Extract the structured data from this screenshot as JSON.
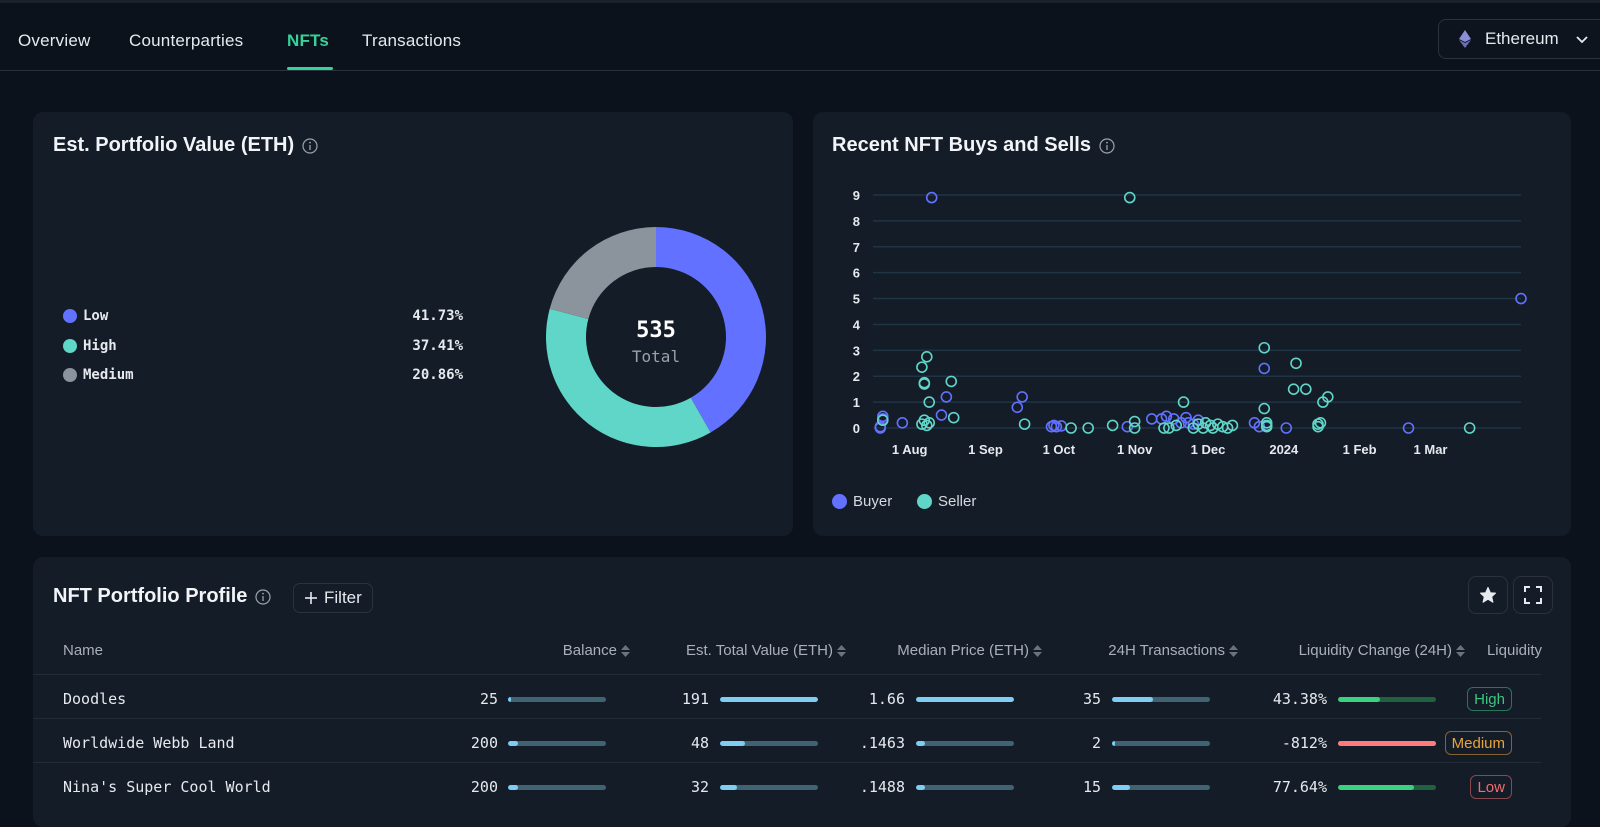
{
  "nav": {
    "tabs": [
      {
        "label": "Overview",
        "active": false
      },
      {
        "label": "Counterparties",
        "active": false
      },
      {
        "label": "NFTs",
        "active": true
      },
      {
        "label": "Transactions",
        "active": false
      }
    ],
    "chain_selector": {
      "label": "Ethereum",
      "icon": "ethereum-icon"
    }
  },
  "colors": {
    "accent": "#35d39a",
    "low": "#6271ff",
    "high": "#5fd6c8",
    "medium": "#8b939c",
    "buyer": "#6271ff",
    "seller": "#5fd6c8"
  },
  "portfolio_value": {
    "title": "Est. Portfolio Value (ETH)",
    "total_value": "535",
    "total_label": "Total",
    "legend": [
      {
        "label": "Low",
        "pct_text": "41.73%",
        "color": "#6271ff"
      },
      {
        "label": "High",
        "pct_text": "37.41%",
        "color": "#5fd6c8"
      },
      {
        "label": "Medium",
        "pct_text": "20.86%",
        "color": "#8b939c"
      }
    ]
  },
  "buys_sells": {
    "title": "Recent NFT Buys and Sells",
    "legend": [
      {
        "label": "Buyer",
        "color": "#6271ff"
      },
      {
        "label": "Seller",
        "color": "#5fd6c8"
      }
    ]
  },
  "chart_data": [
    {
      "type": "pie",
      "title": "Est. Portfolio Value (ETH)",
      "center_text": "535 Total",
      "labels": [
        "Low",
        "High",
        "Medium"
      ],
      "values": [
        41.73,
        37.41,
        20.86
      ],
      "colors": [
        "#6271ff",
        "#5fd6c8",
        "#8b939c"
      ]
    },
    {
      "type": "scatter",
      "title": "Recent NFT Buys and Sells",
      "xlabel": "",
      "ylabel": "",
      "ylim": [
        0,
        9
      ],
      "yticks": [
        "0",
        "1",
        "2",
        "3",
        "4",
        "5",
        "6",
        "7",
        "8",
        "9"
      ],
      "xlim_days": [
        -15,
        250
      ],
      "xticks": [
        {
          "label": "1 Aug",
          "day": 0
        },
        {
          "label": "1 Sep",
          "day": 31
        },
        {
          "label": "1 Oct",
          "day": 61
        },
        {
          "label": "1 Nov",
          "day": 92
        },
        {
          "label": "1 Dec",
          "day": 122
        },
        {
          "label": "2024",
          "day": 153
        },
        {
          "label": "1 Feb",
          "day": 184
        },
        {
          "label": "1 Mar",
          "day": 213
        }
      ],
      "grid": true,
      "legend": "bottom-left",
      "series": [
        {
          "name": "Buyer",
          "color": "#6271ff",
          "points": [
            [
              -12,
              0.0
            ],
            [
              -12,
              0.05
            ],
            [
              -11,
              0.35
            ],
            [
              -11,
              0.45
            ],
            [
              -3,
              0.2
            ],
            [
              13,
              0.5
            ],
            [
              15,
              1.2
            ],
            [
              44,
              0.8
            ],
            [
              46,
              1.2
            ],
            [
              58,
              0.05
            ],
            [
              59,
              0.1
            ],
            [
              60,
              0.05
            ],
            [
              62,
              0.08
            ],
            [
              89,
              0.05
            ],
            [
              99,
              0.35
            ],
            [
              103,
              0.35
            ],
            [
              105,
              0.45
            ],
            [
              108,
              0.35
            ],
            [
              111,
              0.2
            ],
            [
              113,
              0.4
            ],
            [
              114,
              0.2
            ],
            [
              116,
              0.15
            ],
            [
              118,
              0.3
            ],
            [
              9,
              8.9
            ],
            [
              141,
              0.2
            ],
            [
              143,
              0.05
            ],
            [
              145,
              2.3
            ],
            [
              154,
              0.0
            ],
            [
              204,
              0.0
            ],
            [
              250,
              5.0
            ]
          ]
        },
        {
          "name": "Seller",
          "color": "#5fd6c8",
          "points": [
            [
              -11,
              0.3
            ],
            [
              5,
              2.35
            ],
            [
              6,
              1.75
            ],
            [
              6,
              1.7
            ],
            [
              7,
              2.75
            ],
            [
              8,
              1.0
            ],
            [
              5,
              0.15
            ],
            [
              6,
              0.3
            ],
            [
              7,
              0.1
            ],
            [
              8,
              0.2
            ],
            [
              17,
              1.8
            ],
            [
              18,
              0.4
            ],
            [
              47,
              0.15
            ],
            [
              66,
              0.0
            ],
            [
              73,
              0.0
            ],
            [
              83,
              0.1
            ],
            [
              90,
              8.9
            ],
            [
              92,
              0.25
            ],
            [
              92,
              0.0
            ],
            [
              104,
              0.0
            ],
            [
              106,
              0.0
            ],
            [
              109,
              0.1
            ],
            [
              112,
              1.0
            ],
            [
              116,
              0.0
            ],
            [
              118,
              0.15
            ],
            [
              120,
              0.0
            ],
            [
              121,
              0.2
            ],
            [
              123,
              0.1
            ],
            [
              124,
              0.0
            ],
            [
              126,
              0.15
            ],
            [
              128,
              0.05
            ],
            [
              130,
              0.0
            ],
            [
              132,
              0.1
            ],
            [
              145,
              3.1
            ],
            [
              145,
              0.75
            ],
            [
              146,
              0.05
            ],
            [
              146,
              0.2
            ],
            [
              146,
              0.1
            ],
            [
              157,
              1.5
            ],
            [
              158,
              2.5
            ],
            [
              162,
              1.5
            ],
            [
              167,
              0.05
            ],
            [
              167,
              0.15
            ],
            [
              168,
              0.2
            ],
            [
              169,
              1.0
            ],
            [
              171,
              1.2
            ],
            [
              229,
              0.0
            ]
          ]
        }
      ]
    }
  ],
  "table": {
    "title": "NFT Portfolio Profile",
    "filter_label": "Filter",
    "columns": [
      {
        "label": "Name",
        "sortable": false
      },
      {
        "label": "Balance",
        "sortable": true
      },
      {
        "label": "Est. Total Value (ETH)",
        "sortable": true
      },
      {
        "label": "Median Price (ETH)",
        "sortable": true
      },
      {
        "label": "24H Transactions",
        "sortable": true
      },
      {
        "label": "Liquidity Change (24H)",
        "sortable": true
      },
      {
        "label": "Liquidity",
        "sortable": false
      }
    ],
    "rows": [
      {
        "name": "Doodles",
        "balance": "25",
        "balance_fill": 0.02,
        "total_value": "191",
        "total_value_fill": 1.0,
        "median_price": "1.66",
        "median_price_fill": 1.0,
        "tx_24h": "35",
        "tx_24h_fill": 0.42,
        "liq_change": "43.38%",
        "liq_change_fill": 0.43,
        "liq_change_dir": "up",
        "liquidity": "High",
        "liquidity_color": "#3bc47f"
      },
      {
        "name": "Worldwide Webb Land",
        "balance": "200",
        "balance_fill": 0.1,
        "total_value": "48",
        "total_value_fill": 0.25,
        "median_price": ".1463",
        "median_price_fill": 0.09,
        "tx_24h": "2",
        "tx_24h_fill": 0.03,
        "liq_change": "-812%",
        "liq_change_fill": 1.0,
        "liq_change_dir": "down",
        "liquidity": "Medium",
        "liquidity_color": "#e8a33d"
      },
      {
        "name": "Nina's Super Cool World",
        "balance": "200",
        "balance_fill": 0.1,
        "total_value": "32",
        "total_value_fill": 0.17,
        "median_price": ".1488",
        "median_price_fill": 0.09,
        "tx_24h": "15",
        "tx_24h_fill": 0.18,
        "liq_change": "77.64%",
        "liq_change_fill": 0.78,
        "liq_change_dir": "up",
        "liquidity": "Low",
        "liquidity_color": "#f06e6e"
      }
    ]
  }
}
